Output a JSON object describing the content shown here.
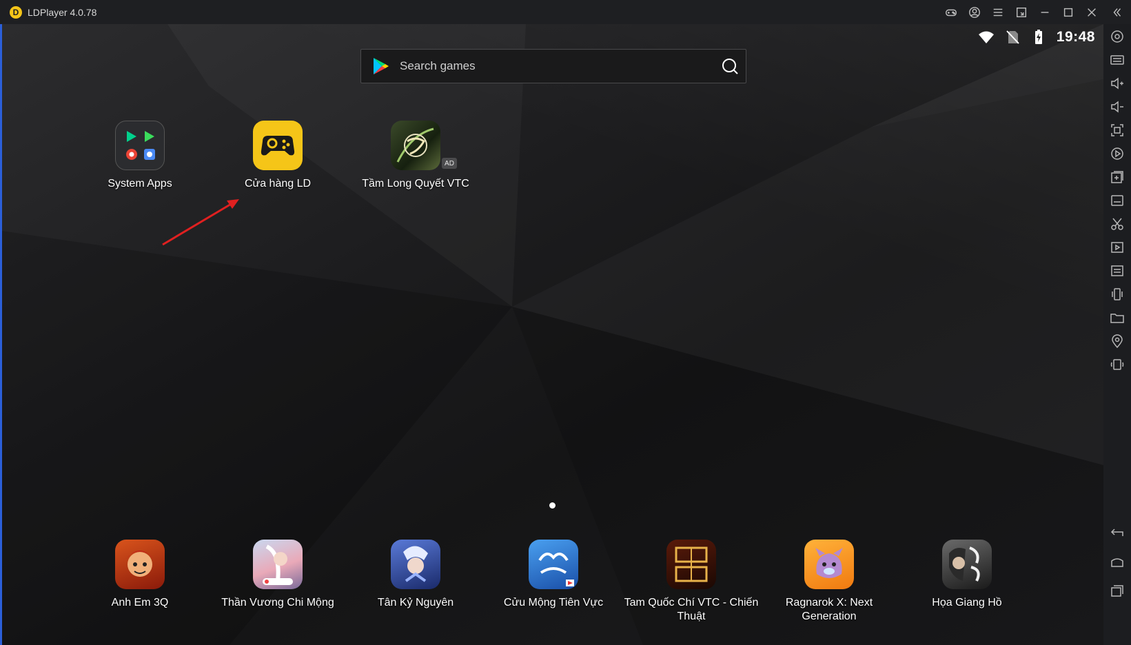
{
  "window": {
    "title": "LDPlayer 4.0.78",
    "logo_letter": "D"
  },
  "status_bar": {
    "time": "19:48"
  },
  "search": {
    "placeholder": "Search games"
  },
  "desktop_apps": [
    {
      "label": "System Apps"
    },
    {
      "label": "Cửa hàng LD"
    },
    {
      "label": "Tầm Long Quyết VTC",
      "badge": "AD"
    }
  ],
  "dock_apps": [
    {
      "label": "Anh Em 3Q"
    },
    {
      "label": "Thần Vương Chi Mộng"
    },
    {
      "label": "Tân Kỷ Nguyên"
    },
    {
      "label": "Cửu Mộng Tiên Vực"
    },
    {
      "label": "Tam Quốc Chí VTC - Chiến Thuật"
    },
    {
      "label": "Ragnarok X: Next Generation"
    },
    {
      "label": "Họa Giang Hồ"
    }
  ],
  "colors": {
    "accent_yellow": "#f5c518",
    "annotation_arrow": "#e02020",
    "left_strip": "#2b5fd9"
  }
}
